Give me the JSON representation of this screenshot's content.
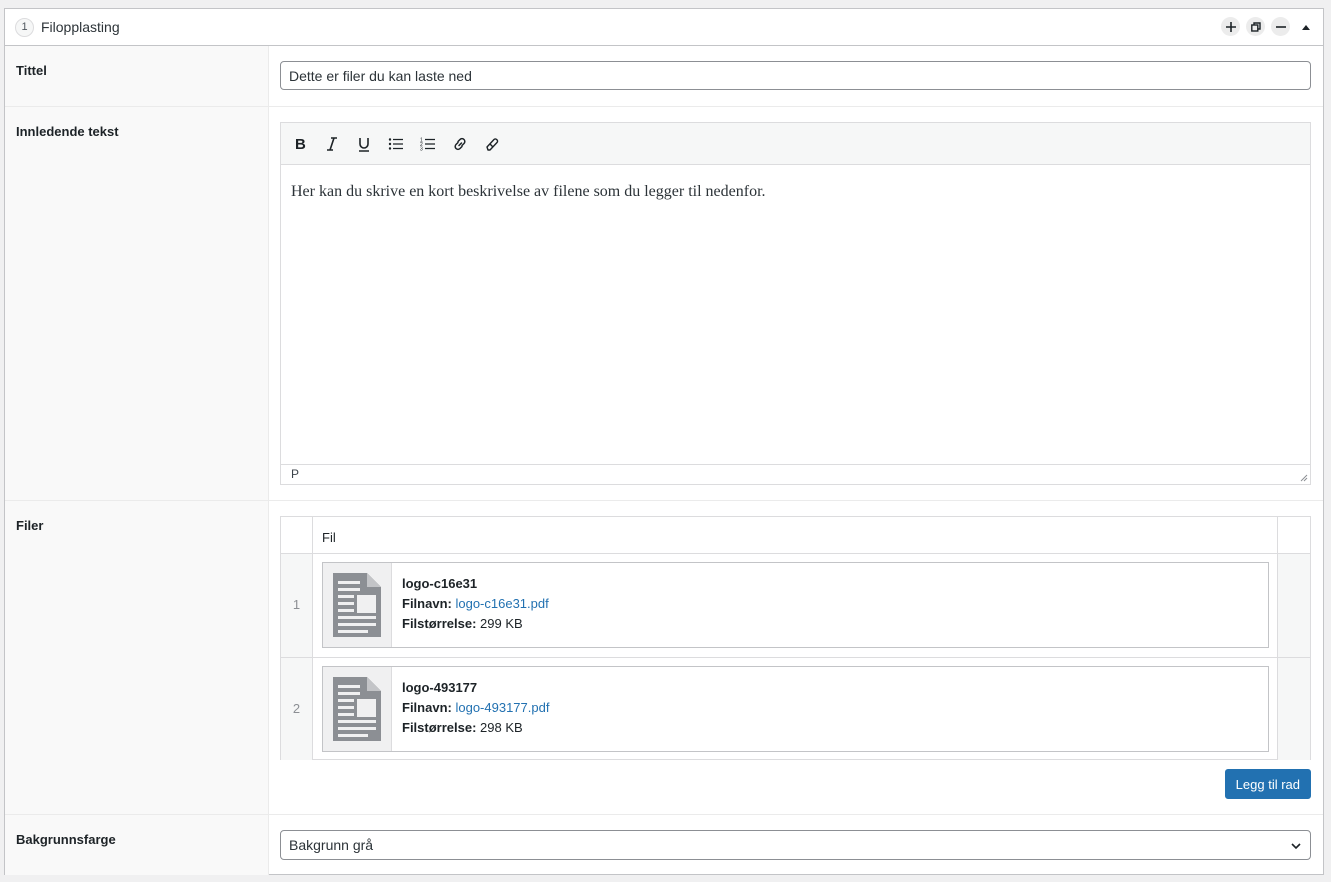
{
  "layout": {
    "order": "1",
    "title": "Filopplasting"
  },
  "fields": {
    "title": {
      "label": "Tittel",
      "value": "Dette er filer du kan laste ned"
    },
    "intro": {
      "label": "Innledende tekst",
      "body": "Her kan du skrive en kort beskrivelse av filene som du legger til nedenfor.",
      "status_path": "P",
      "toolbar": [
        "bold-icon",
        "italic-icon",
        "underline-icon",
        "bullet-list-icon",
        "numbered-list-icon",
        "link-icon",
        "unlink-icon"
      ]
    },
    "files": {
      "label": "Filer",
      "column_header": "Fil",
      "filename_label": "Filnavn:",
      "filesize_label": "Filstørrelse:",
      "rows": [
        {
          "order": "1",
          "title": "logo-c16e31",
          "filename": "logo-c16e31.pdf",
          "filesize": "299 KB"
        },
        {
          "order": "2",
          "title": "logo-493177",
          "filename": "logo-493177.pdf",
          "filesize": "298 KB"
        }
      ],
      "add_row_label": "Legg til rad"
    },
    "background": {
      "label": "Bakgrunnsfarge",
      "selected": "Bakgrunn grå"
    }
  },
  "colors": {
    "accent": "#2271b1",
    "border": "#c3c4c7",
    "label_bg": "#f9f9f9"
  }
}
